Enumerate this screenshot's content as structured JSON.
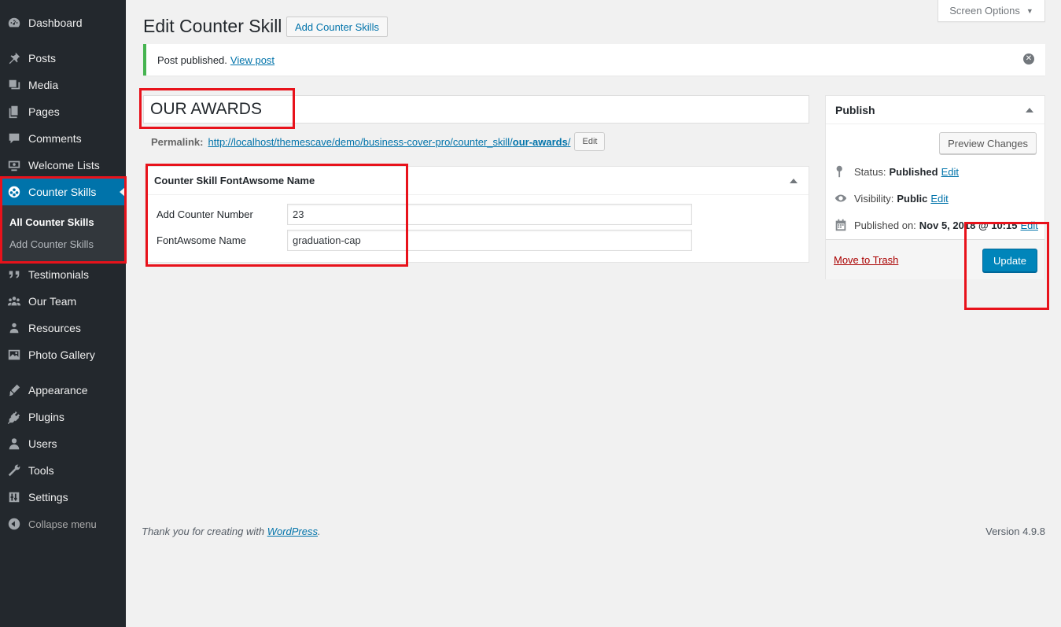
{
  "sidebar": {
    "items": [
      {
        "label": "Dashboard",
        "icon": "dashboard-icon"
      },
      {
        "label": "Posts",
        "icon": "pin-icon"
      },
      {
        "label": "Media",
        "icon": "media-icon"
      },
      {
        "label": "Pages",
        "icon": "pages-icon"
      },
      {
        "label": "Comments",
        "icon": "comment-icon"
      },
      {
        "label": "Welcome Lists",
        "icon": "welcome-icon"
      },
      {
        "label": "Counter Skills",
        "icon": "counter-icon"
      },
      {
        "label": "Testimonials",
        "icon": "quote-icon"
      },
      {
        "label": "Our Team",
        "icon": "groups-icon"
      },
      {
        "label": "Resources",
        "icon": "resources-icon"
      },
      {
        "label": "Photo Gallery",
        "icon": "gallery-icon"
      },
      {
        "label": "Appearance",
        "icon": "appearance-icon"
      },
      {
        "label": "Plugins",
        "icon": "plugins-icon"
      },
      {
        "label": "Users",
        "icon": "users-icon"
      },
      {
        "label": "Tools",
        "icon": "tools-icon"
      },
      {
        "label": "Settings",
        "icon": "settings-icon"
      }
    ],
    "submenu": [
      "All Counter Skills",
      "Add Counter Skills"
    ],
    "collapse_label": "Collapse menu"
  },
  "header": {
    "title": "Edit Counter Skill",
    "add_new_label": "Add Counter Skills",
    "screen_options_label": "Screen Options"
  },
  "notice": {
    "text": "Post published.",
    "link": "View post"
  },
  "editor": {
    "title_value": "OUR AWARDS",
    "permalink_label": "Permalink:",
    "permalink_url_base": "http://localhost/themescave/demo/business-cover-pro/counter_skill/",
    "permalink_slug": "our-awards",
    "permalink_trailing": "/",
    "edit_label": "Edit"
  },
  "metabox": {
    "title": "Counter Skill FontAwsome Name",
    "fields": [
      {
        "label": "Add Counter Number",
        "value": "23"
      },
      {
        "label": "FontAwsome Name",
        "value": "graduation-cap"
      }
    ]
  },
  "publish": {
    "title": "Publish",
    "preview_label": "Preview Changes",
    "status_label": "Status:",
    "status_value": "Published",
    "visibility_label": "Visibility:",
    "visibility_value": "Public",
    "published_label": "Published on:",
    "published_value": "Nov 5, 2018 @ 10:15",
    "edit_link": "Edit",
    "trash_label": "Move to Trash",
    "update_label": "Update"
  },
  "footer": {
    "thanks_prefix": "Thank you for creating with",
    "thanks_link": "WordPress",
    "thanks_suffix": ".",
    "version": "Version 4.9.8"
  },
  "colors": {
    "sidebar_bg": "#23282d",
    "active_bg": "#0073aa",
    "primary_button": "#0085ba",
    "link": "#0073aa",
    "trash": "#a00",
    "notice_border": "#46b450",
    "highlight": "#e8121b"
  }
}
